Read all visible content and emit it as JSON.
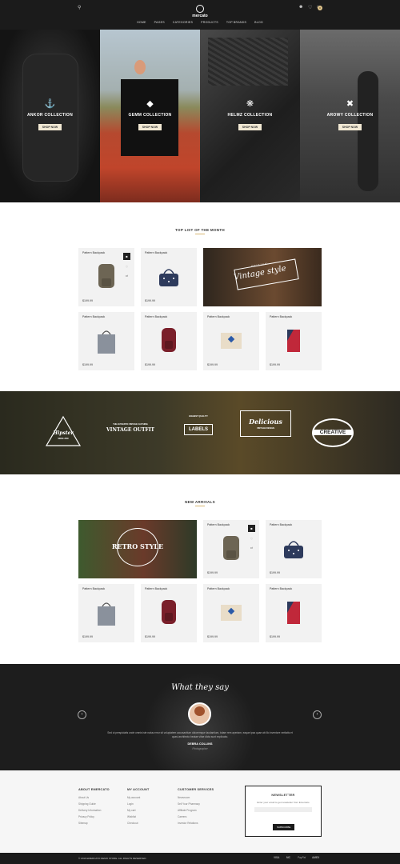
{
  "brand": {
    "name": "mercato"
  },
  "nav": [
    "HOME",
    "PAGES",
    "CATEGORIES",
    "PRODUCTS",
    "TOP BRANDS",
    "BLOG"
  ],
  "cart_count": "0",
  "hero": [
    {
      "title": "ANKOR COLLECTION",
      "button": "SHOP NOW",
      "icon": "anchor-icon"
    },
    {
      "title": "GEMM COLLECTION",
      "button": "SHOP NOW",
      "icon": "diamond-icon"
    },
    {
      "title": "HELMZ COLLECTION",
      "button": "SHOP NOW",
      "icon": "helm-icon"
    },
    {
      "title": "AROWY COLLECTION",
      "button": "SHOP NOW",
      "icon": "arrows-icon"
    }
  ],
  "top_list": {
    "title": "TOP LIST OF THE MONTH",
    "promo": "Vintage style",
    "promo_small": "ORIGINAL",
    "products": [
      {
        "name": "Pattern Backpack",
        "price": "$199.99",
        "color": "#6d6554",
        "shape": "backpack"
      },
      {
        "name": "Pattern Backpack",
        "price": "$199.99",
        "color": "#2d3a5c",
        "shape": "duffel"
      },
      {
        "name": "Pattern Backpack",
        "price": "$199.99",
        "color": "#8a919c",
        "shape": "tote"
      },
      {
        "name": "Pattern Backpack",
        "price": "$199.99",
        "color": "#7a1f2a",
        "shape": "backpack"
      },
      {
        "name": "Pattern Backpack",
        "price": "$199.99",
        "color": "#e9ddc8",
        "shape": "pouch"
      },
      {
        "name": "Pattern Backpack",
        "price": "$199.99",
        "color": "#c0283a",
        "shape": "wallet"
      }
    ]
  },
  "banner_badges": [
    {
      "big": "Hipster",
      "small": "SINCE 2009"
    },
    {
      "big": "VINTAGE OUTFIT",
      "small": "THE AUTHENTIC VINTAGE CLOTHING"
    },
    {
      "big": "LABELS",
      "small": "HIGHEST QUALITY"
    },
    {
      "big": "Delicious",
      "small": "VINTAGE DESIGN"
    },
    {
      "big": "CREATIVE",
      "small": ""
    }
  ],
  "new_arrivals": {
    "title": "NEW ARRIVALS",
    "promo": "RETRO STYLE",
    "products": [
      {
        "name": "Pattern Backpack",
        "price": "$199.99",
        "color": "#6d6554",
        "shape": "backpack"
      },
      {
        "name": "Pattern Backpack",
        "price": "$199.99",
        "color": "#2d3a5c",
        "shape": "duffel"
      },
      {
        "name": "Pattern Backpack",
        "price": "$199.99",
        "color": "#8a919c",
        "shape": "tote"
      },
      {
        "name": "Pattern Backpack",
        "price": "$199.99",
        "color": "#7a1f2a",
        "shape": "backpack"
      },
      {
        "name": "Pattern Backpack",
        "price": "$199.99",
        "color": "#e9ddc8",
        "shape": "pouch"
      },
      {
        "name": "Pattern Backpack",
        "price": "$199.99",
        "color": "#c0283a",
        "shape": "wallet"
      }
    ]
  },
  "testimonial": {
    "title": "What they say",
    "quote": "Sed ut perspiciatis unde omnis iste natus error sit voluptatem accusantium doloremque laudantium, totam rem aperiam, eaque ipsa quae ab illo inventore veritatis et quasi architecto beatae vitae dicta sunt explicabo.",
    "name": "DEBRA COLLINS",
    "role": "Photographer"
  },
  "footer": {
    "about": {
      "title": "ABOUT EMERCATO",
      "links": [
        "About Us",
        "Shipping Guide",
        "Delivery Information",
        "Privacy Policy",
        "Sitemap"
      ]
    },
    "account": {
      "title": "MY ACCOUNT",
      "links": [
        "My account",
        "Login",
        "My cart",
        "Wishlist",
        "Checkout"
      ]
    },
    "service": {
      "title": "CUSTOMER SERVICES",
      "links": [
        "Newsroom",
        "Sell Your Pharmacy",
        "Affiliate Program",
        "Careers",
        "Investor Relations"
      ]
    },
    "newsletter": {
      "title": "NEWSLETTER",
      "text": "Enter your email to get newsletter from Emercato",
      "button": "SUBSCRIBE"
    },
    "copyright": "© 2016 EMERCATO DEMO STORE. ALL RIGHTS RESERVED.",
    "payments": [
      "VISA",
      "MC",
      "PayPal",
      "AMEX"
    ]
  },
  "colors": {
    "accent": "#d9b873",
    "dark": "#1b1b1b"
  }
}
